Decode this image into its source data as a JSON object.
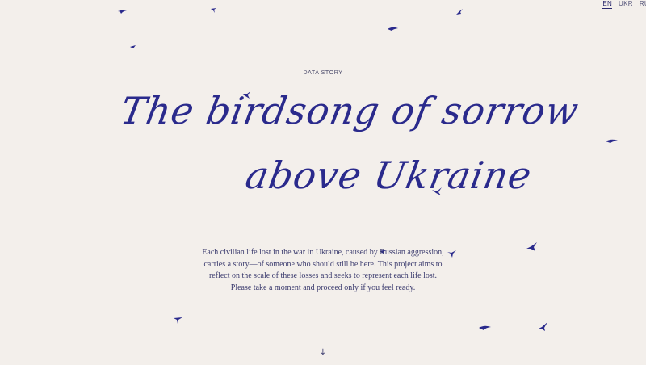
{
  "language_switch": {
    "items": [
      {
        "label": "EN",
        "active": true
      },
      {
        "label": "UKR",
        "active": false
      },
      {
        "label": "RU",
        "active": false
      }
    ]
  },
  "hero": {
    "eyebrow": "DATA STORY",
    "title_line_1": "The birdsong of sorrow",
    "title_line_2": "above Ukraine",
    "intro": "Each civilian life lost in the war in Ukraine, caused by Russian aggression, carries a story—of someone who should still be here. This project aims to reflect on the scale of these losses and seeks to represent each life lost. Please take a moment and proceed only if you feel ready.",
    "scroll_hint": "↓"
  },
  "colors": {
    "background": "#f3efeb",
    "ink": "#2a2a8c",
    "text": "#3b3b6e"
  },
  "icons": {
    "bird": "swallow-bird-icon",
    "arrow": "arrow-down-icon"
  }
}
